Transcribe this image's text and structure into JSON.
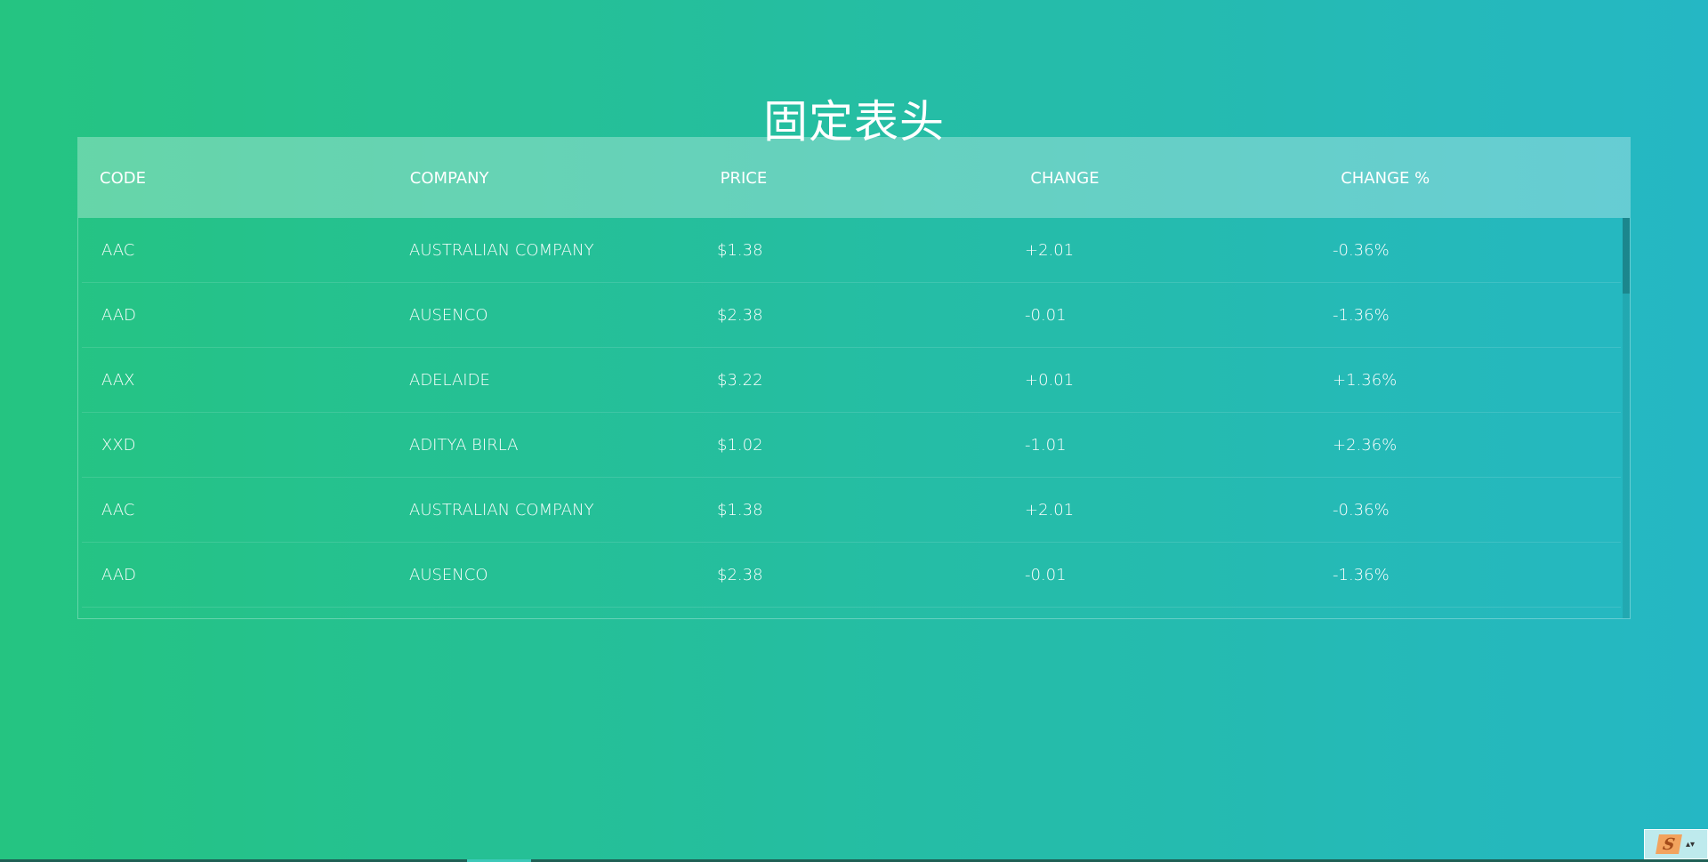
{
  "page": {
    "title": "固定表头"
  },
  "table": {
    "headers": [
      "CODE",
      "COMPANY",
      "PRICE",
      "CHANGE",
      "CHANGE %"
    ],
    "rows": [
      [
        "AAC",
        "AUSTRALIAN COMPANY",
        "$1.38",
        "+2.01",
        "-0.36%"
      ],
      [
        "AAD",
        "AUSENCO",
        "$2.38",
        "-0.01",
        "-1.36%"
      ],
      [
        "AAX",
        "ADELAIDE",
        "$3.22",
        "+0.01",
        "+1.36%"
      ],
      [
        "XXD",
        "ADITYA BIRLA",
        "$1.02",
        "-1.01",
        "+2.36%"
      ],
      [
        "AAC",
        "AUSTRALIAN COMPANY",
        "$1.38",
        "+2.01",
        "-0.36%"
      ],
      [
        "AAD",
        "AUSENCO",
        "$2.38",
        "-0.01",
        "-1.36%"
      ]
    ]
  },
  "tray": {
    "logo_text": "S",
    "arrows": "▴▾"
  },
  "colors": {
    "gradient_start": "#25c481",
    "gradient_end": "#25b7c4"
  }
}
